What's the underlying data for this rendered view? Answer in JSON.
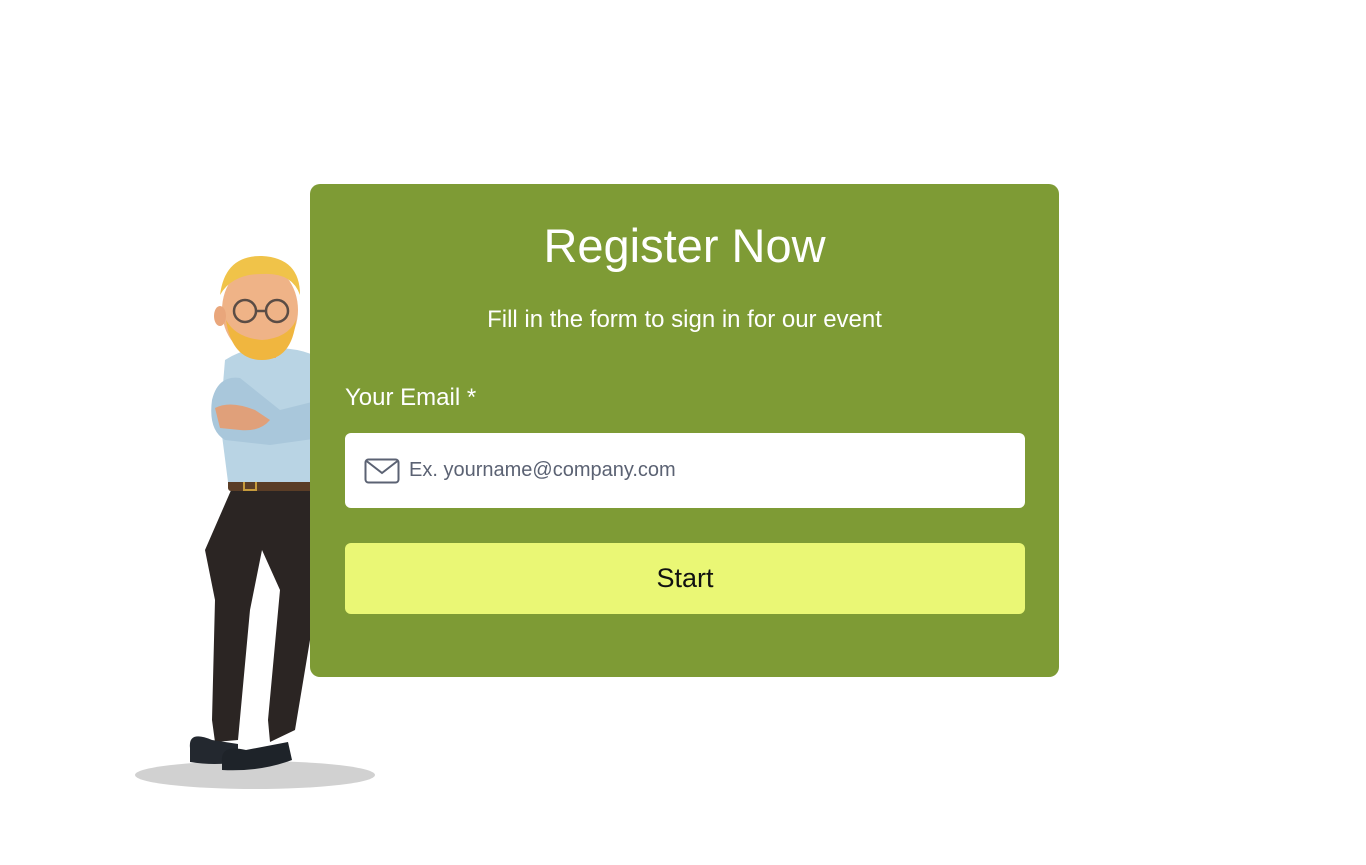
{
  "form": {
    "title": "Register Now",
    "subtitle": "Fill in the form to sign in for our event",
    "email_label": "Your Email *",
    "email_placeholder": "Ex. yourname@company.com",
    "email_value": "",
    "submit_label": "Start"
  },
  "icons": {
    "email_field_icon": "envelope-icon",
    "illustration": "character-illustration"
  },
  "colors": {
    "card_background": "#7e9b35",
    "button_background": "#eaf775",
    "text_on_card": "#ffffff"
  }
}
